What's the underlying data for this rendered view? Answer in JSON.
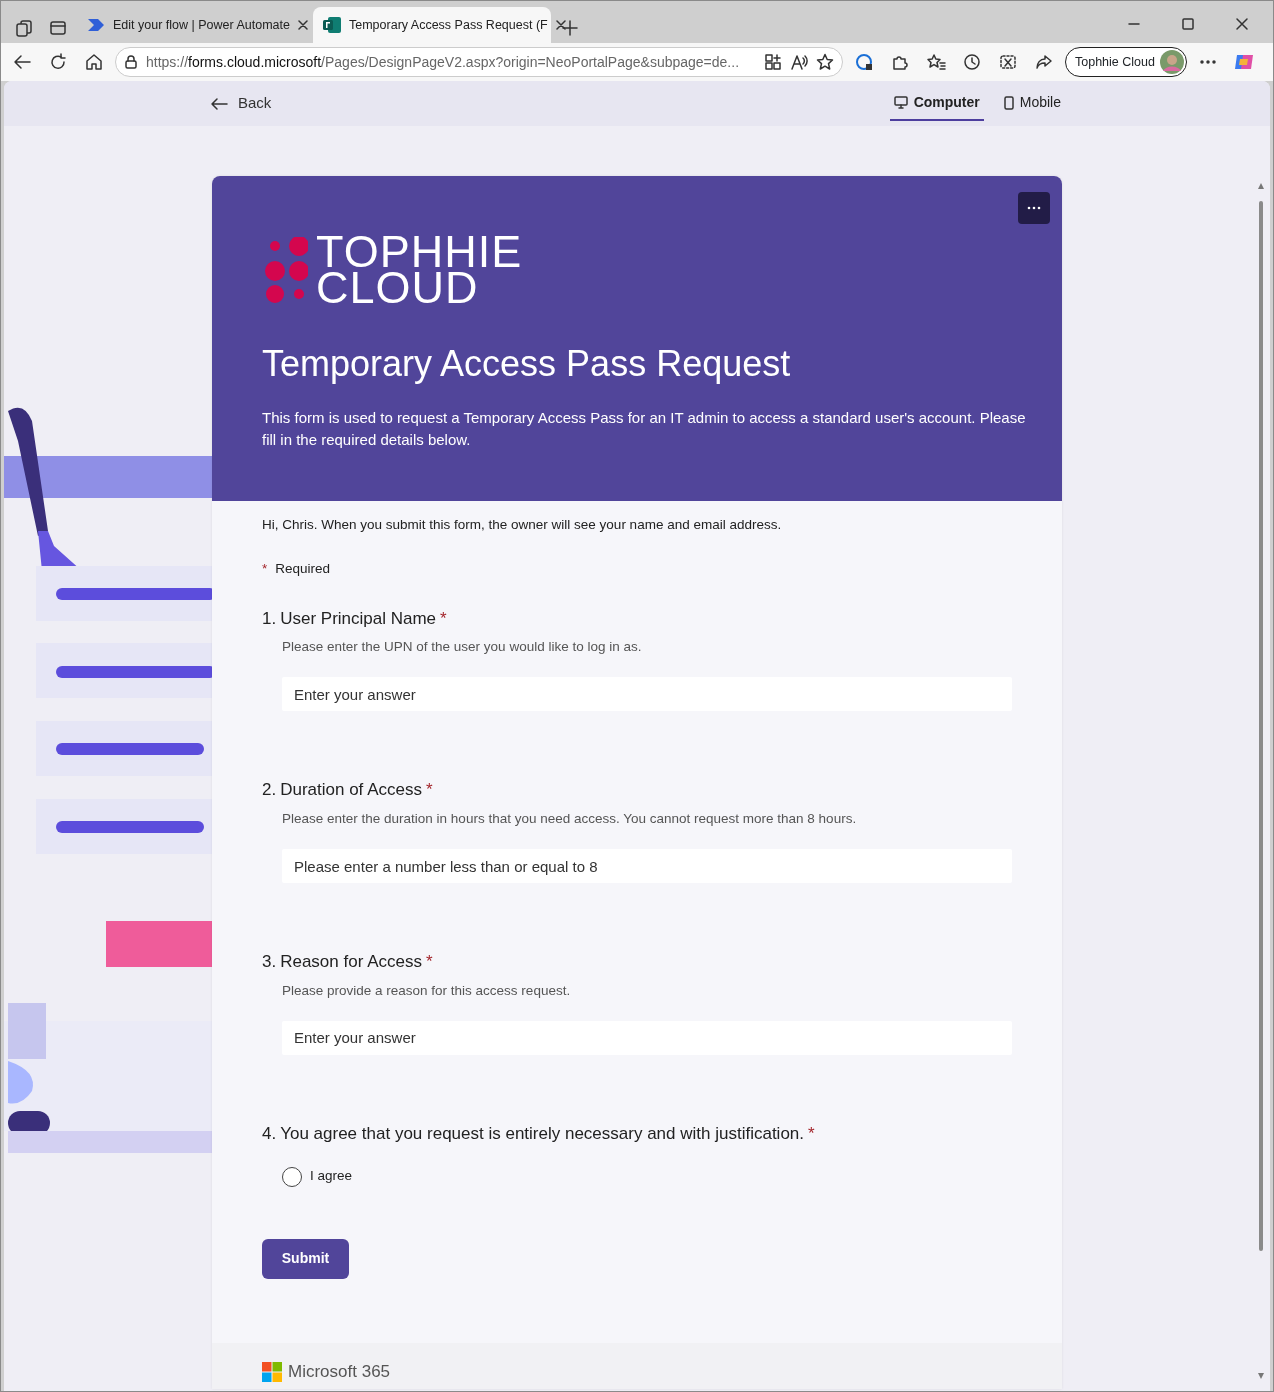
{
  "browser": {
    "tabs": [
      {
        "title": "Edit your flow | Power Automate",
        "selected": false
      },
      {
        "title": "Temporary Access Pass Request (F",
        "selected": true
      }
    ],
    "url": {
      "scheme": "https://",
      "host": "forms.cloud.microsoft",
      "rest": "/Pages/DesignPageV2.aspx?origin=NeoPortalPage&subpage=de..."
    },
    "profile": "Tophhie Cloud"
  },
  "toolbar": {
    "back": "Back",
    "views": [
      {
        "label": "Computer",
        "selected": true
      },
      {
        "label": "Mobile",
        "selected": false
      }
    ]
  },
  "form": {
    "logo_lines": [
      "TOPHHIE",
      "CLOUD"
    ],
    "title": "Temporary Access Pass Request",
    "description": "This form is used to request a Temporary Access Pass for an IT admin to access a standard user's account. Please fill in the required details below.",
    "notice": "Hi, Chris. When you submit this form, the owner will see your name and email address.",
    "required_mark": "*",
    "required_label": "Required",
    "questions": [
      {
        "number": "1.",
        "title": "User Principal Name",
        "required": true,
        "subtitle": "Please enter the UPN of the user you would like to log in as.",
        "kind": "text",
        "placeholder": "Enter your answer"
      },
      {
        "number": "2.",
        "title": "Duration of Access",
        "required": true,
        "subtitle": "Please enter the duration in hours that you need access. You cannot request more than 8 hours.",
        "kind": "text",
        "placeholder": "Please enter a number less than or equal to 8"
      },
      {
        "number": "3.",
        "title": "Reason for Access",
        "required": true,
        "subtitle": "Please provide a reason for this access request.",
        "kind": "text",
        "placeholder": "Enter your answer"
      },
      {
        "number": "4.",
        "title": "You agree that you request is entirely necessary and with justification.",
        "required": true,
        "kind": "choice",
        "options": [
          {
            "label": "I agree",
            "selected": false
          }
        ]
      }
    ],
    "submit": "Submit",
    "footer": "Microsoft 365"
  }
}
